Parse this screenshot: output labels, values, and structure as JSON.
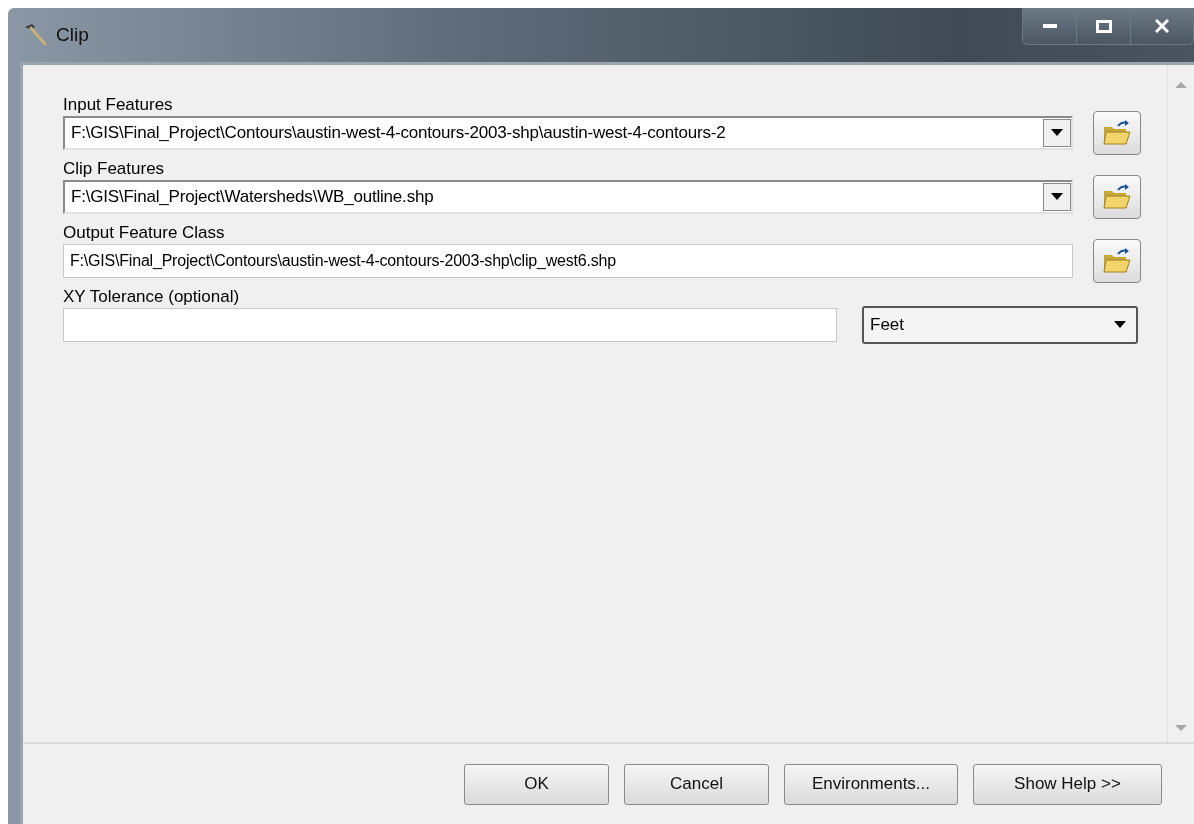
{
  "window": {
    "title": "Clip"
  },
  "parameters": [
    {
      "label": "Input Features",
      "kind": "dropdown",
      "value": "F:\\GIS\\Final_Project\\Contours\\austin-west-4-contours-2003-shp\\austin-west-4-contours-2"
    },
    {
      "label": "Clip Features",
      "kind": "dropdown",
      "value": "F:\\GIS\\Final_Project\\Watersheds\\WB_outline.shp"
    },
    {
      "label": "Output Feature Class",
      "kind": "text",
      "value": "F:\\GIS\\Final_Project\\Contours\\austin-west-4-contours-2003-shp\\clip_west6.shp"
    },
    {
      "label": "XY Tolerance (optional)",
      "kind": "tolerance",
      "unit": "Feet"
    }
  ],
  "buttons": [
    "OK",
    "Cancel",
    "Environments...",
    "Show Help >>"
  ]
}
